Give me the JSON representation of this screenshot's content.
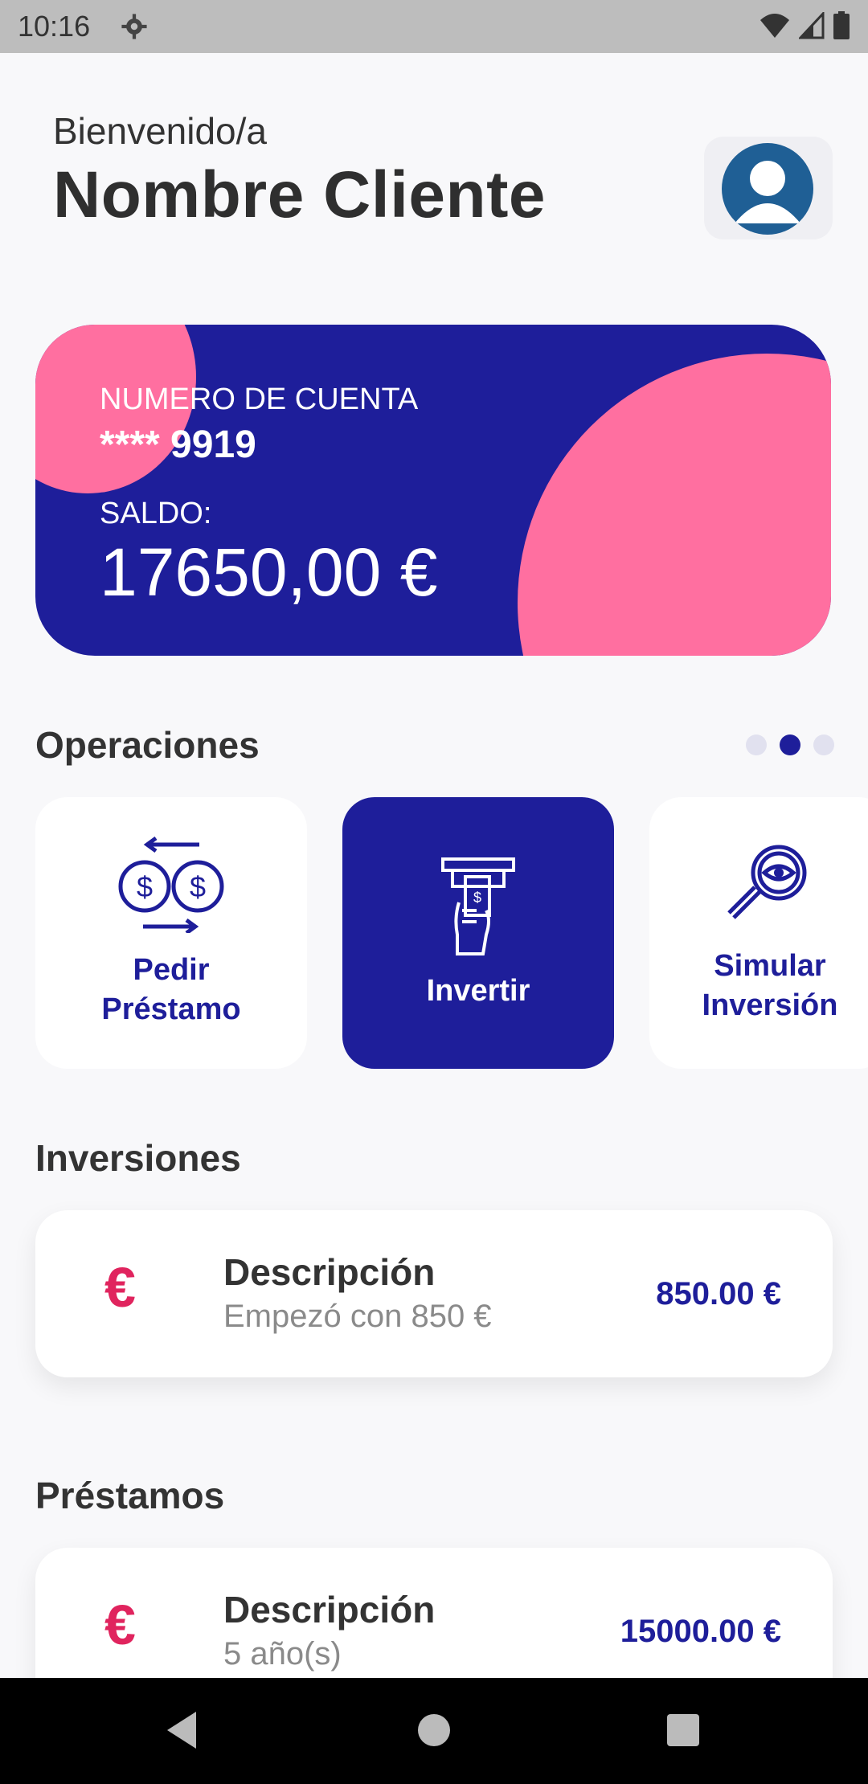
{
  "status_bar": {
    "time": "10:16"
  },
  "header": {
    "welcome": "Bienvenido/a",
    "name": "Nombre Cliente"
  },
  "account_card": {
    "account_label": "NUMERO DE CUENTA",
    "account_number": "**** 9919",
    "balance_label": "SALDO:",
    "balance": "17650,00 €"
  },
  "operations": {
    "title": "Operaciones",
    "pager_active_index": 1,
    "items": [
      {
        "line1": "Pedir",
        "line2": "Préstamo",
        "icon": "exchange-dollar-icon"
      },
      {
        "line1": "Invertir",
        "line2": "",
        "icon": "atm-cash-icon"
      },
      {
        "line1": "Simular",
        "line2": "Inversión",
        "icon": "magnifier-eye-icon"
      }
    ]
  },
  "investments": {
    "title": "Inversiones",
    "items": [
      {
        "currency": "€",
        "title": "Descripción",
        "subtitle": "Empezó con 850 €",
        "amount": "850.00 €"
      }
    ]
  },
  "loans": {
    "title": "Préstamos",
    "items": [
      {
        "currency": "€",
        "title": "Descripción",
        "subtitle": "5 año(s)",
        "amount": "15000.00 €"
      }
    ]
  },
  "colors": {
    "primary": "#1e1e9a",
    "accent": "#ff6fa0",
    "euro": "#e0245e"
  }
}
